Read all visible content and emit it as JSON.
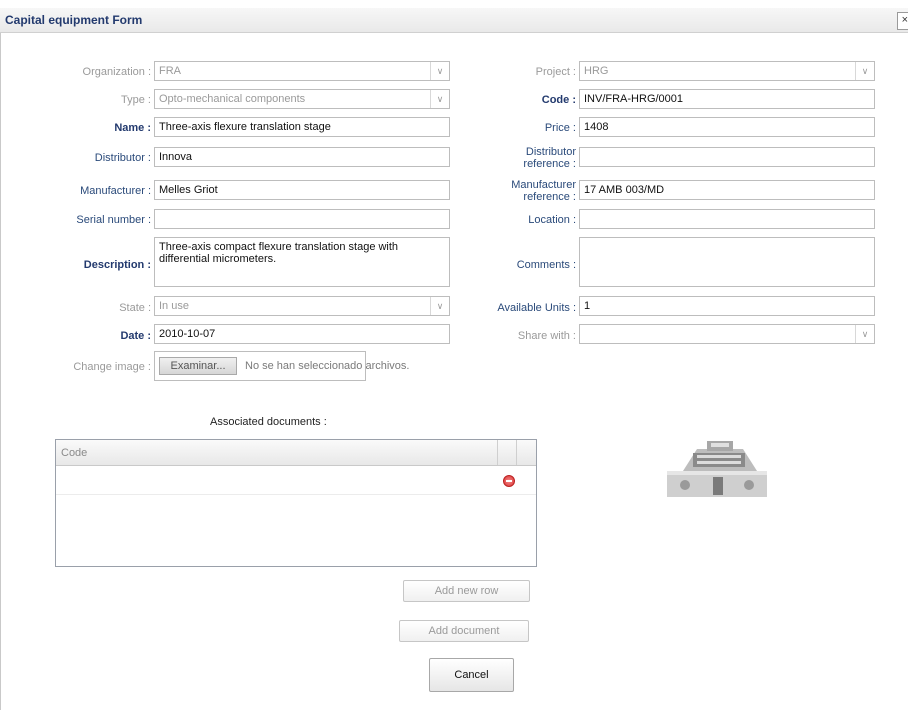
{
  "window": {
    "title": "Capital equipment Form",
    "close_label": "×"
  },
  "left": {
    "organization": {
      "label": "Organization :",
      "value": "FRA"
    },
    "type": {
      "label": "Type :",
      "value": "Opto-mechanical components"
    },
    "name": {
      "label": "Name :",
      "value": "Three-axis flexure translation stage"
    },
    "distributor": {
      "label": "Distributor :",
      "value": "Innova"
    },
    "manufacturer": {
      "label": "Manufacturer :",
      "value": "Melles Griot"
    },
    "serial_number": {
      "label": "Serial number :",
      "value": ""
    },
    "description": {
      "label": "Description :",
      "value": "Three-axis compact flexure translation stage with differential micrometers."
    },
    "state": {
      "label": "State :",
      "value": "In use"
    },
    "date": {
      "label": "Date :",
      "value": "2010-10-07"
    },
    "change_image": {
      "label": "Change image :",
      "button": "Examinar...",
      "status": "No se han seleccionado archivos."
    }
  },
  "right": {
    "project": {
      "label": "Project :",
      "value": "HRG"
    },
    "code": {
      "label": "Code :",
      "value": "INV/FRA-HRG/0001"
    },
    "price": {
      "label": "Price :",
      "value": "1408"
    },
    "distributor_reference": {
      "label_line1": "Distributor",
      "label_line2": "reference :",
      "value": ""
    },
    "manufacturer_reference": {
      "label_line1": "Manufacturer",
      "label_line2": "reference :",
      "value": "17 AMB 003/MD"
    },
    "location": {
      "label": "Location :",
      "value": ""
    },
    "comments": {
      "label": "Comments :",
      "value": ""
    },
    "available_units": {
      "label": "Available Units :",
      "value": "1"
    },
    "share_with": {
      "label": "Share with :",
      "value": ""
    }
  },
  "documents": {
    "title": "Associated documents :",
    "column_code": "Code",
    "add_row_label": "Add new row",
    "add_document_label": "Add document"
  },
  "cancel_label": "Cancel",
  "icons": {
    "dropdown": "chevron-down-icon",
    "delete": "delete-row-icon",
    "image": "stage-photo"
  },
  "colors": {
    "label_blue": "#233a6e",
    "disabled_gray": "#9a9a9a",
    "delete_red": "#d93131"
  }
}
